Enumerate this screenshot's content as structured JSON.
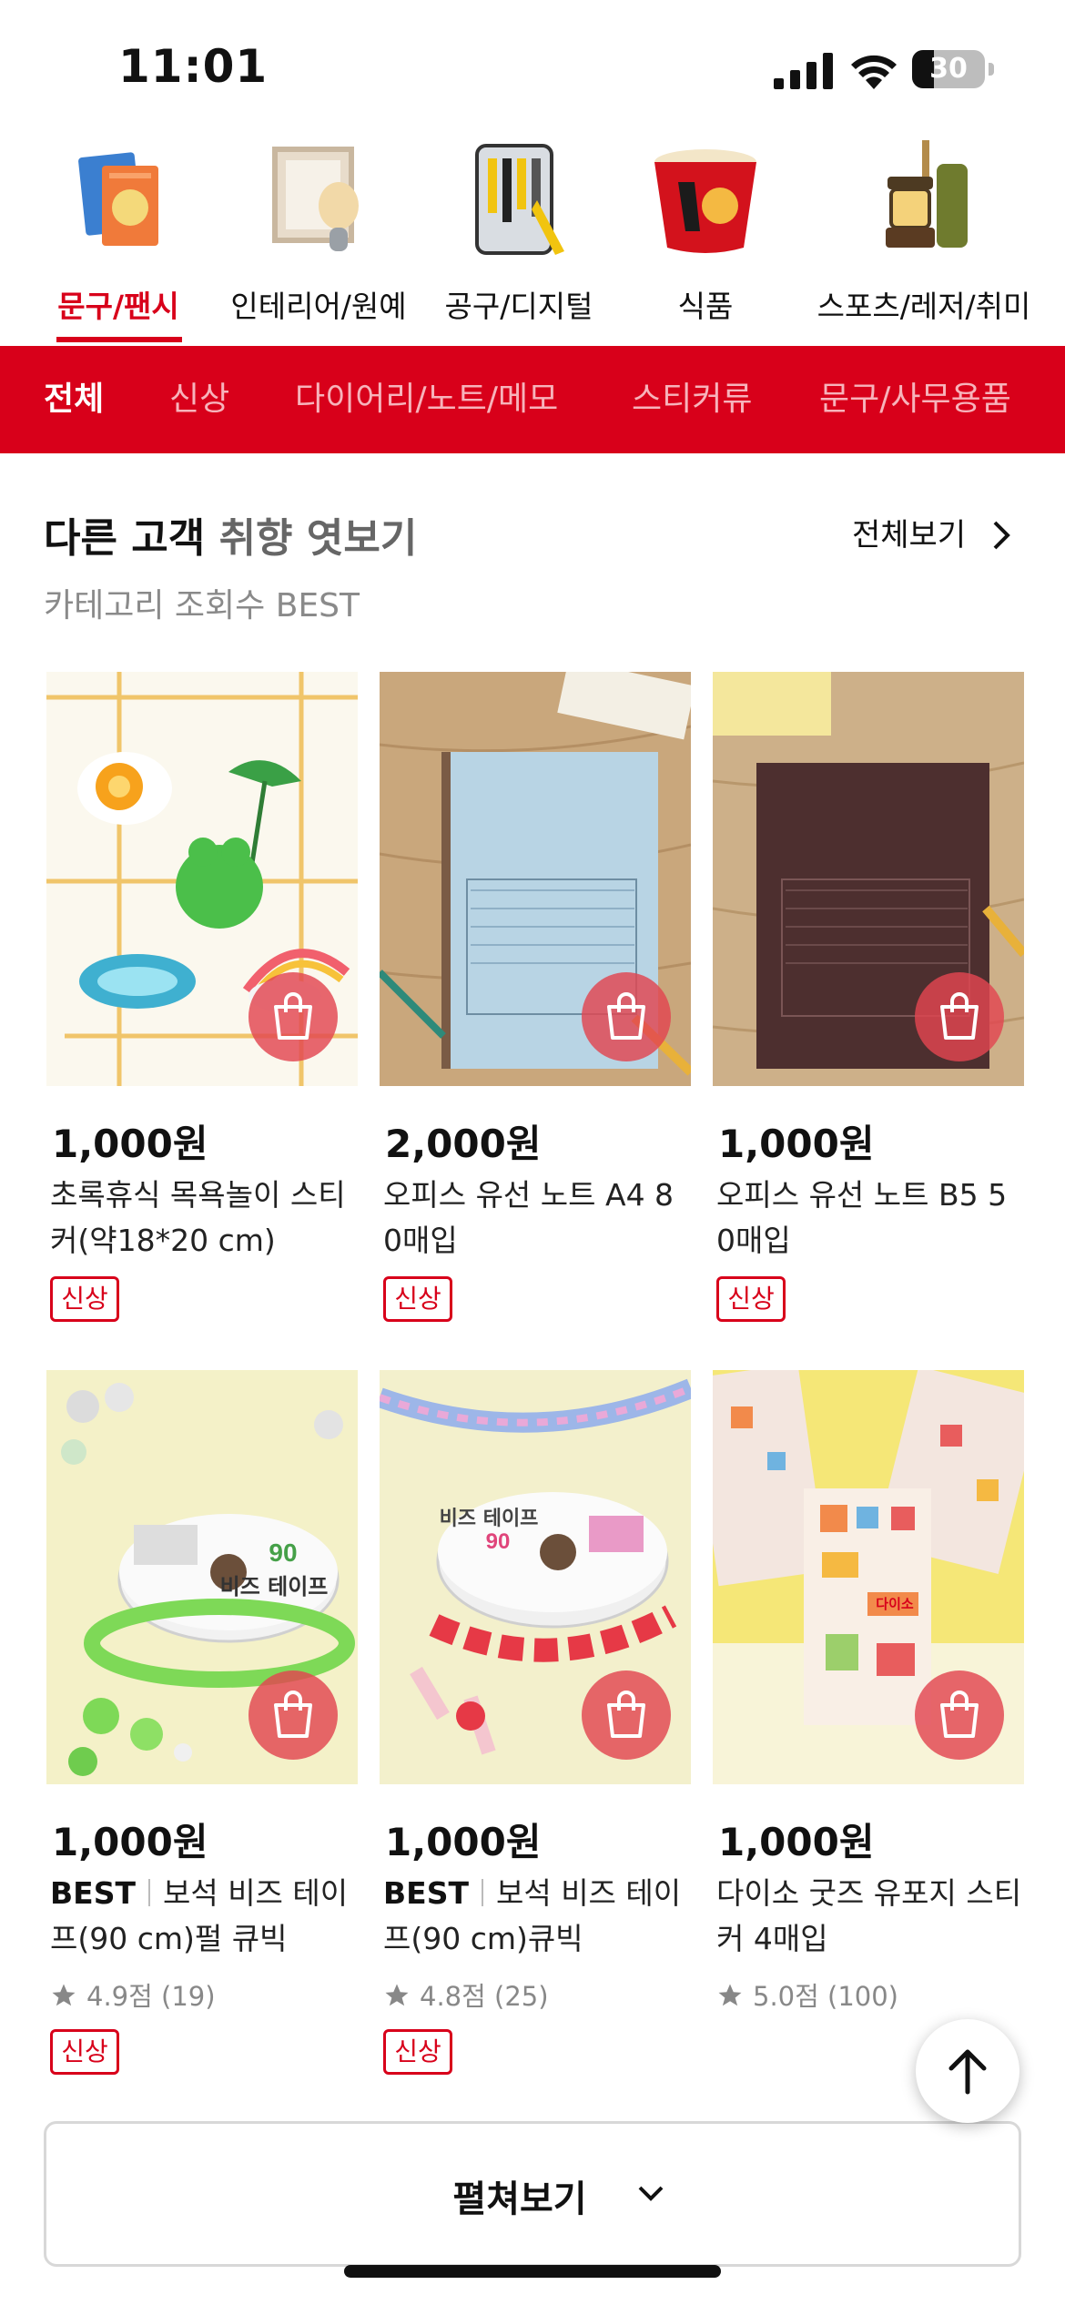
{
  "status_bar": {
    "time": "11:01",
    "battery": "30",
    "battery_level": 0.3
  },
  "categories": [
    {
      "label": "문구/팬시",
      "active": true,
      "icon": "notebook-icon"
    },
    {
      "label": "인테리어/원예",
      "active": false,
      "icon": "frame-lamp-icon"
    },
    {
      "label": "공구/디지털",
      "active": false,
      "icon": "tool-kit-icon"
    },
    {
      "label": "식품",
      "active": false,
      "icon": "noodle-cup-icon"
    },
    {
      "label": "스포츠/레저/취미",
      "active": false,
      "icon": "camping-lantern-icon"
    }
  ],
  "tabs": [
    {
      "label": "전체",
      "active": true
    },
    {
      "label": "신상",
      "active": false
    },
    {
      "label": "다이어리/노트/메모",
      "active": false
    },
    {
      "label": "스티커류",
      "active": false
    },
    {
      "label": "문구/사무용품",
      "active": false
    }
  ],
  "section": {
    "title_main": "다른 고객",
    "title_accent": "취향 엿보기",
    "subtitle": "카테고리 조회수 BEST",
    "view_all": "전체보기"
  },
  "products": [
    {
      "price": "1,000원",
      "name": "초록휴식 목욕놀이 스티커(약18*20 cm)",
      "badge": "신상"
    },
    {
      "price": "2,000원",
      "name": "오피스 유선 노트 A4 80매입",
      "badge": "신상"
    },
    {
      "price": "1,000원",
      "name": "오피스 유선 노트 B5 50매입",
      "badge": "신상"
    },
    {
      "price": "1,000원",
      "best": "BEST",
      "name": "보석 비즈 테이프(90 cm)펄 큐빅",
      "rating": "4.9점 (19)",
      "badge": "신상",
      "product_label_a": "90",
      "product_label_b": "비즈 테이프"
    },
    {
      "price": "1,000원",
      "best": "BEST",
      "name": "보석 비즈 테이프(90 cm)큐빅",
      "rating": "4.8점 (25)",
      "badge": "신상",
      "product_label_a": "비즈 테이프",
      "product_label_b": "90"
    },
    {
      "price": "1,000원",
      "name": "다이소 굿즈 유포지 스티커 4매입",
      "rating": "5.0점 (100)",
      "product_label_a": "다이소"
    }
  ],
  "expand_button": "펼쳐보기",
  "colors": {
    "brand_red": "#d8001a",
    "cart_button": "#e24650"
  }
}
